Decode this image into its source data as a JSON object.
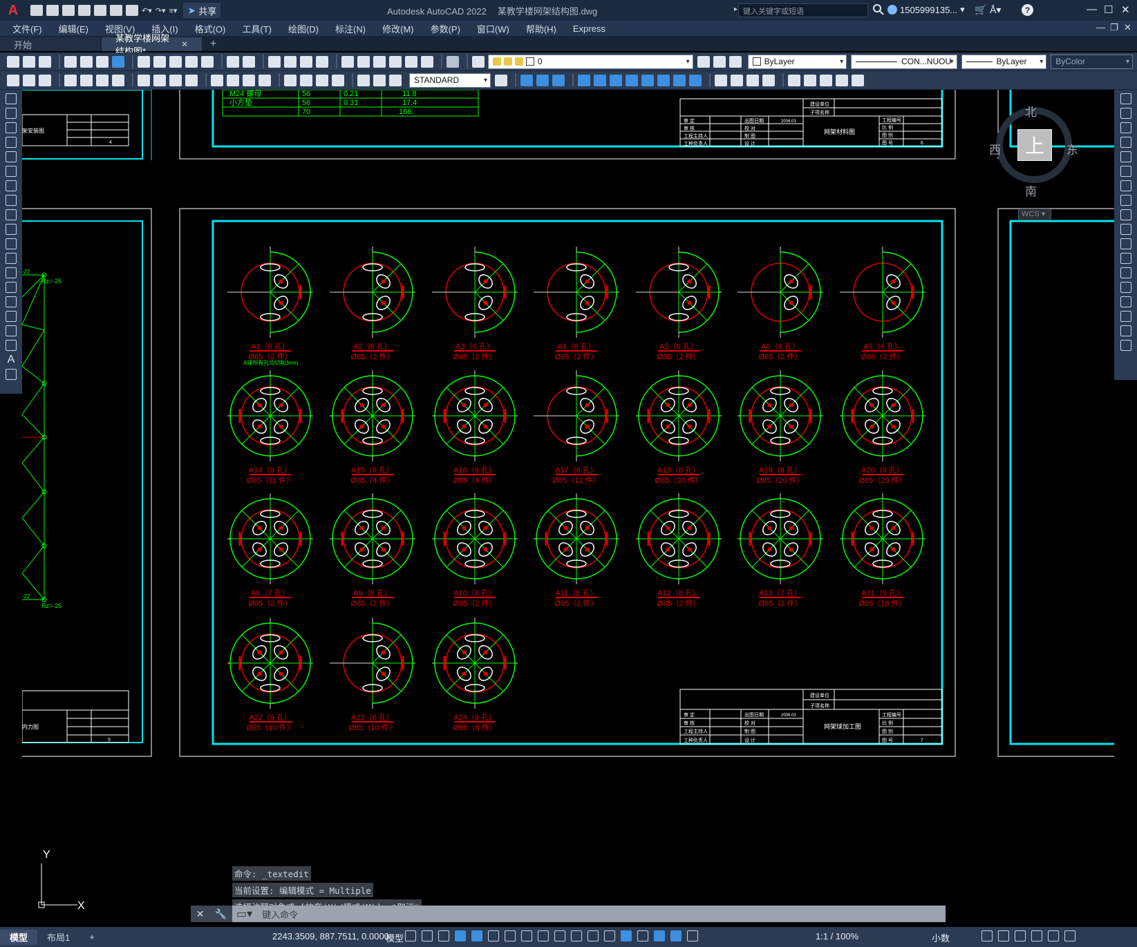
{
  "app": {
    "title": "Autodesk AutoCAD 2022",
    "file": "某教学楼网架结构图.dwg",
    "logo": "A"
  },
  "qat": {
    "share": "共享"
  },
  "search": {
    "placeholder": "键入关键字或短语"
  },
  "user": {
    "name": "1505999135..."
  },
  "menu": [
    "文件(F)",
    "编辑(E)",
    "视图(V)",
    "插入(I)",
    "格式(O)",
    "工具(T)",
    "绘图(D)",
    "标注(N)",
    "修改(M)",
    "参数(P)",
    "窗口(W)",
    "帮助(H)",
    "Express"
  ],
  "tabs": {
    "start": "开始",
    "active": "某教学楼网架结构图*"
  },
  "props": {
    "layer": "0",
    "color": "ByLayer",
    "linetype": "CON...NUOU",
    "lineweight": "ByLayer",
    "plotstyle": "ByColor",
    "textstyle": "STANDARD"
  },
  "viewcube": {
    "n": "北",
    "s": "南",
    "w": "西",
    "e": "东",
    "face": "上",
    "wcs": "WCS"
  },
  "drawing": {
    "table_rows": [
      [
        "M24 螺母",
        "56",
        "0.21",
        "11.8"
      ],
      [
        "小方垫",
        "56",
        "0.31",
        "17.4"
      ],
      [
        "",
        "70",
        "",
        "166."
      ]
    ],
    "tb_top": {
      "design_unit": "建设单位",
      "project_name": "子项名称",
      "title": "网架材料图",
      "sheet": "6",
      "date_label": "出图日期",
      "date": "2006.03",
      "r1": "审 定",
      "r2": "审 核",
      "r3": "工程主持人",
      "r4": "工种负责人",
      "r5": "校 对",
      "r6": "制 图",
      "r7": "设 计",
      "n1": "工程编号",
      "n2": "比 例",
      "n3": "图 别",
      "n4": "图 号"
    },
    "tb_bottom": {
      "design_unit": "建设单位",
      "project_name": "子项名称",
      "title": "网架球加工图",
      "sheet": "7",
      "date": "2006.03"
    },
    "left_tb1": {
      "title": "架安装图",
      "sheet": "4"
    },
    "left_tb2": {
      "title": "内力图",
      "sheet": "5"
    },
    "truss_labels": [
      "Rz=-25",
      "Rz=-25",
      "-22",
      "-22"
    ],
    "note": "A球所有孔均切削3mm",
    "balls": [
      [
        "A1（6 孔）",
        "Ø85（2 件）"
      ],
      [
        "A2（6 孔）",
        "Ø85（2 件）"
      ],
      [
        "A3（6 孔）",
        "Ø85（2 件）"
      ],
      [
        "A4（6 孔）",
        "Ø85（2 件）"
      ],
      [
        "A5（6 孔）",
        "Ø85（2 件）"
      ],
      [
        "A6（4 孔）",
        "Ø85（2 件）"
      ],
      [
        "A7（4 孔）",
        "Ø85（2 件）"
      ],
      [
        "A14（9 孔）",
        "Ø85（11 件）"
      ],
      [
        "A15（9 孔）",
        "Ø85（4 件）"
      ],
      [
        "A16（9 孔）",
        "Ø85（4 件）"
      ],
      [
        "A17（6 孔）",
        "Ø85（12 件）"
      ],
      [
        "A18（8 孔）",
        "Ø85（20 件）"
      ],
      [
        "A19（8 孔）",
        "Ø85（20 件）"
      ],
      [
        "A20（9 孔）",
        "Ø85（20 件）"
      ],
      [
        "A8（7 孔）",
        "Ø85（2 件）"
      ],
      [
        "A9（8 孔）",
        "Ø85（2 件）"
      ],
      [
        "A10（8 孔）",
        "Ø85（2 件）"
      ],
      [
        "A11（8 孔）",
        "Ø85（2 件）"
      ],
      [
        "A12（8 孔）",
        "Ø85（2 件）"
      ],
      [
        "A13（7 孔）",
        "Ø85（2 件）"
      ],
      [
        "A21（9 孔）",
        "Ø85（18 件）"
      ],
      [
        "A22（9 孔）",
        "Ø85（10 件）"
      ],
      [
        "A23（6 孔）",
        "Ø85（10 件）"
      ],
      [
        "A24（9 孔）",
        "Ø85（8 件）"
      ]
    ]
  },
  "command": {
    "history": [
      "命令: _textedit",
      "当前设置: 编辑模式 = Multiple",
      "选择注释对象或 [放弃(U)/模式(M)]: *取消*"
    ],
    "placeholder": "键入命令"
  },
  "ucs": {
    "x": "X",
    "y": "Y"
  },
  "status": {
    "tab_model": "模型",
    "tab_layout": "布局1",
    "coords": "2243.3509, 887.7511, 0.0000",
    "model": "模型",
    "scale": "1:1 / 100%",
    "units": "小数"
  }
}
